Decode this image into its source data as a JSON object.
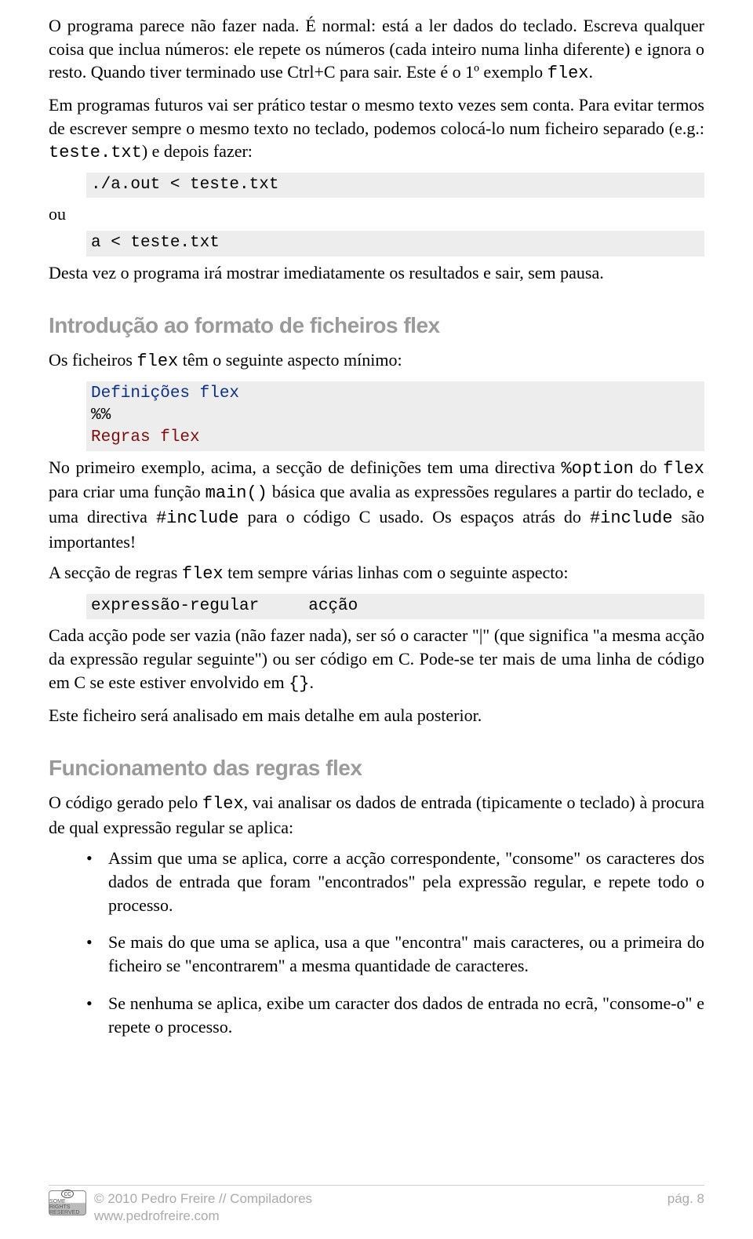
{
  "intro": {
    "p1_a": "O programa parece não fazer nada. É normal: está a ler dados do teclado. Escreva qualquer coisa que inclua números: ele repete os números (cada inteiro numa linha diferente) e ignora o resto. Quando tiver terminado use Ctrl+C para sair. Este é o 1º exemplo ",
    "p1_flex": "flex",
    "p1_b": ".",
    "p2_a": "Em programas futuros vai ser prático testar o mesmo texto vezes sem conta. Para evitar termos de escrever sempre o mesmo texto no teclado, podemos colocá-lo num ficheiro separado (e.g.: ",
    "p2_teste": "teste.txt",
    "p2_b": ") e depois fazer:",
    "code1": "./a.out < teste.txt",
    "ou": "ou",
    "code2": "a < teste.txt",
    "p3": "Desta vez o programa irá mostrar imediatamente os resultados e sair, sem pausa."
  },
  "sec1": {
    "title": "Introdução ao formato de ficheiros flex",
    "p1_a": "Os ficheiros ",
    "p1_flex": "flex",
    "p1_b": " têm o seguinte aspecto mínimo:",
    "code_def_line1": "Definições flex",
    "code_def_line2": "%%",
    "code_def_line3": "Regras flex",
    "p2_a": "No primeiro exemplo, acima, a secção de definições tem uma directiva ",
    "p2_option": "%option",
    "p2_b": " do ",
    "p2_flex": "flex",
    "p2_c": " para criar uma função ",
    "p2_main": "main()",
    "p2_d": " básica que avalia as expressões regulares a partir do teclado, e uma directiva ",
    "p2_include": "#include",
    "p2_e": " para o código C usado. Os espaços atrás do ",
    "p2_include2": "#include",
    "p2_f": " são importantes!",
    "p3_a": "A secção de regras ",
    "p3_flex": "flex",
    "p3_b": " tem sempre várias linhas com o seguinte aspecto:",
    "code_rule": "expressão-regular     acção",
    "p4_a": "Cada acção pode ser vazia (não fazer nada), ser só o caracter \"|\" (que significa \"a mesma acção da expressão regular seguinte\") ou ser código em C. Pode-se ter mais de uma linha de código em C se este estiver envolvido em ",
    "p4_braces": "{}",
    "p4_b": ".",
    "p5": "Este ficheiro será analisado em mais detalhe em aula posterior."
  },
  "sec2": {
    "title": "Funcionamento das regras flex",
    "p1_a": "O código gerado pelo ",
    "p1_flex": "flex",
    "p1_b": ", vai analisar os dados de entrada (tipicamente o teclado) à procura de qual expressão regular se aplica:",
    "bullets": [
      "Assim que uma se aplica, corre a acção correspondente, \"consome\" os caracteres dos dados de entrada que foram \"encontrados\" pela expressão regular, e repete todo o processo.",
      "Se mais do que uma se aplica, usa a que \"encontra\" mais caracteres, ou a primeira do ficheiro se \"encontrarem\" a mesma quantidade de caracteres.",
      "Se nenhuma se aplica, exibe um caracter dos dados de entrada no ecrã, \"consome-o\" e repete o processo."
    ]
  },
  "footer": {
    "cc_symbol": "cc",
    "cc_text": "SOME RIGHTS RESERVED",
    "line1": "© 2010 Pedro Freire  //  Compiladores",
    "line2": "www.pedrofreire.com",
    "page": "pág. 8"
  }
}
